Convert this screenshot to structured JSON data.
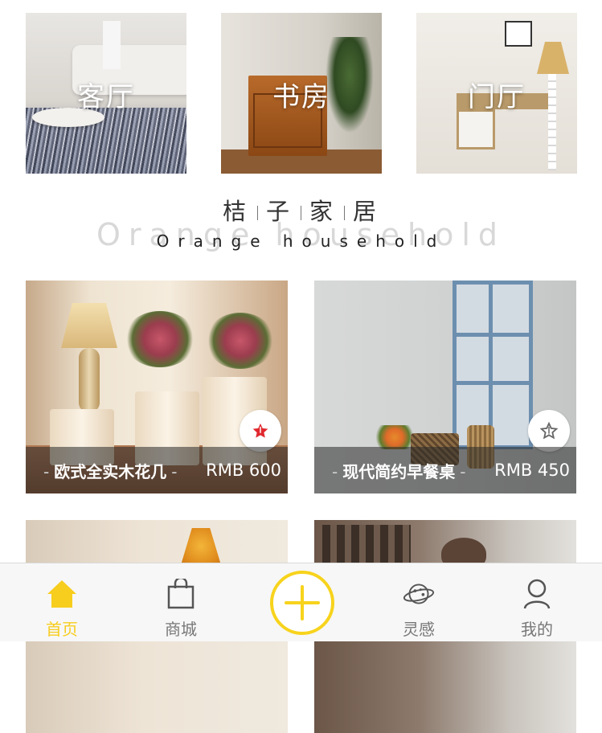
{
  "rooms": [
    {
      "label": "客厅"
    },
    {
      "label": "书房"
    },
    {
      "label": "门厅"
    }
  ],
  "brand": {
    "chars": [
      "桔",
      "子",
      "家",
      "居"
    ],
    "en_background": "Orange household",
    "en_foreground": "Orange household"
  },
  "products": [
    {
      "name": "欧式全实木花几",
      "price": "RMB 600",
      "favorite": true
    },
    {
      "name": "现代简约早餐桌",
      "price": "RMB 450",
      "favorite": false
    }
  ],
  "tabbar": {
    "tabs": [
      {
        "label": "首页",
        "icon": "home-icon",
        "active": true
      },
      {
        "label": "商城",
        "icon": "shopping-bag-icon",
        "active": false
      },
      {
        "label": "灵感",
        "icon": "planet-icon",
        "active": false
      },
      {
        "label": "我的",
        "icon": "user-icon",
        "active": false
      }
    ],
    "center_icon": "plus-icon"
  },
  "colors": {
    "accent": "#f7cd1e",
    "favorite_active": "#e0282e",
    "favorite_inactive": "#666666",
    "tab_inactive": "#777777"
  }
}
